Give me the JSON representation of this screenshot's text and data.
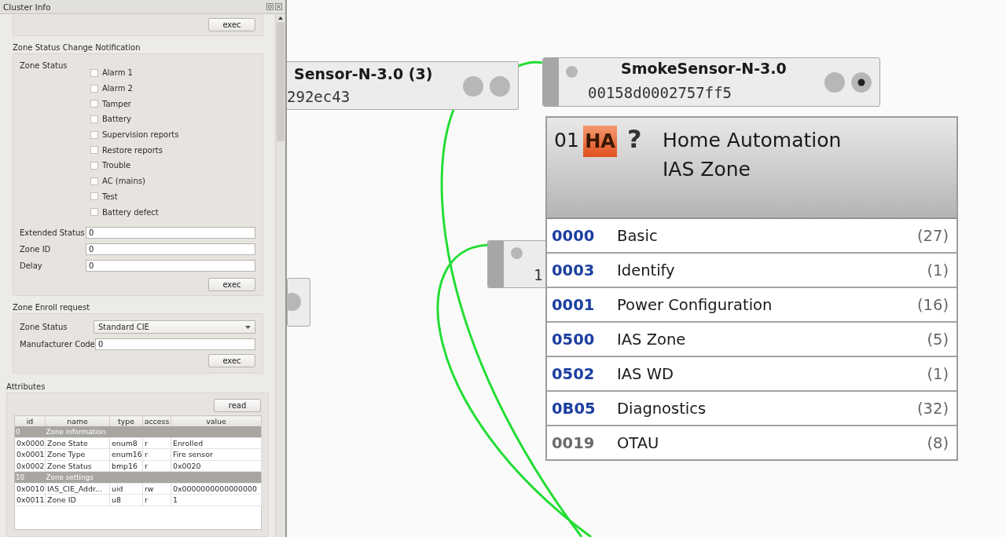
{
  "panel": {
    "title": "Cluster Info",
    "top_button": "exec"
  },
  "notification": {
    "title": "Zone Status Change Notification",
    "status_label": "Zone Status",
    "flags": [
      {
        "label": "Alarm 1",
        "checked": false
      },
      {
        "label": "Alarm 2",
        "checked": false
      },
      {
        "label": "Tamper",
        "checked": false
      },
      {
        "label": "Battery",
        "checked": false
      },
      {
        "label": "Supervision reports",
        "checked": false
      },
      {
        "label": "Restore reports",
        "checked": false
      },
      {
        "label": "Trouble",
        "checked": false
      },
      {
        "label": "AC (mains)",
        "checked": false
      },
      {
        "label": "Test",
        "checked": false
      },
      {
        "label": "Battery defect",
        "checked": false
      }
    ],
    "fields": [
      {
        "label": "Extended Status",
        "value": "0"
      },
      {
        "label": "Zone ID",
        "value": "0"
      },
      {
        "label": "Delay",
        "value": "0"
      }
    ],
    "button": "exec"
  },
  "enroll": {
    "title": "Zone Enroll request",
    "zone_status": {
      "label": "Zone Status",
      "value": "Standard CIE"
    },
    "fields": [
      {
        "label": "Manufacturer Code",
        "value": "0"
      }
    ],
    "button": "exec"
  },
  "attributes": {
    "title": "Attributes",
    "button": "read",
    "columns": [
      "id",
      "name",
      "type",
      "access",
      "value"
    ],
    "rows": [
      {
        "kind": "group",
        "cells": [
          "0",
          "Zone information"
        ]
      },
      {
        "kind": "attribute",
        "cells": [
          "0x0000",
          "Zone State",
          "enum8",
          "r",
          "Enrolled"
        ]
      },
      {
        "kind": "attribute",
        "cells": [
          "0x0001",
          "Zone Type",
          "enum16",
          "r",
          "Fire sensor"
        ]
      },
      {
        "kind": "attribute",
        "cells": [
          "0x0002",
          "Zone Status",
          "bmp16",
          "r",
          "0x0020"
        ]
      },
      {
        "kind": "group",
        "cells": [
          "10",
          "Zone settings"
        ]
      },
      {
        "kind": "attribute",
        "cells": [
          "0x0010",
          "IAS_CIE_Addr...",
          "uid",
          "rw",
          "0x0000000000000000"
        ]
      },
      {
        "kind": "attribute",
        "cells": [
          "0x0011",
          "Zone ID",
          "u8",
          "r",
          "1"
        ]
      }
    ]
  },
  "nodes": [
    {
      "kind": "partial",
      "title": "Sensor-N-3.0 (3)",
      "address": "292ec43"
    },
    {
      "kind": "full",
      "title": "SmokeSensor-N-3.0",
      "address": "00158d0002757ff5"
    },
    {
      "kind": "covered",
      "address": "1"
    },
    {
      "kind": "stub"
    }
  ],
  "endpoint": {
    "number": "01",
    "profile": "HA",
    "device": "?",
    "profile_name": "Home Automation",
    "device_name": "IAS Zone",
    "clusters": [
      {
        "id": "0000",
        "name": "Basic",
        "count": "(27)",
        "kind": "server"
      },
      {
        "id": "0003",
        "name": "Identify",
        "count": "(1)",
        "kind": "server"
      },
      {
        "id": "0001",
        "name": "Power Configuration",
        "count": "(16)",
        "kind": "server"
      },
      {
        "id": "0500",
        "name": "IAS Zone",
        "count": "(5)",
        "kind": "server"
      },
      {
        "id": "0502",
        "name": "IAS WD",
        "count": "(1)",
        "kind": "server"
      },
      {
        "id": "0B05",
        "name": "Diagnostics",
        "count": "(32)",
        "kind": "server"
      },
      {
        "id": "0019",
        "name": "OTAU",
        "count": "(8)",
        "kind": "client"
      }
    ]
  }
}
